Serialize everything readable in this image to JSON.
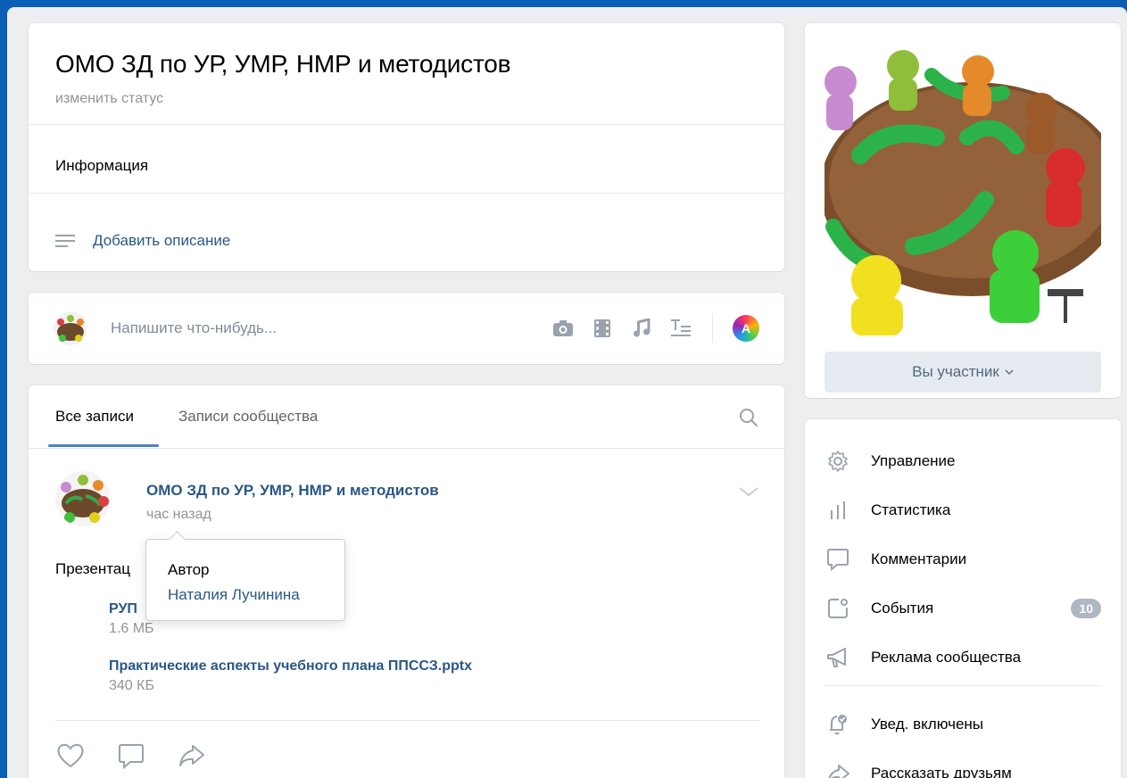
{
  "group": {
    "title": "ОМО ЗД по УР, УМР, НМР и методистов",
    "status_link": "изменить статус",
    "info_label": "Информация",
    "add_description": "Добавить описание"
  },
  "composer": {
    "placeholder": "Напишите что-нибудь...",
    "tools": [
      "camera-icon",
      "video-icon",
      "music-icon",
      "text-format-icon",
      "letter-a-icon"
    ],
    "letter_a": "A"
  },
  "feed": {
    "tabs": [
      {
        "label": "Все записи",
        "active": true
      },
      {
        "label": "Записи сообщества",
        "active": false
      }
    ],
    "post": {
      "author": "ОМО ЗД по УР, УМР, НМР и методистов",
      "time": "час назад",
      "text": "Презентац",
      "docs": [
        {
          "name": "РУП",
          "size": "1.6 МБ"
        },
        {
          "name": "Практические аспекты учебного плана ППССЗ.pptx",
          "size": "340 КБ"
        }
      ]
    },
    "tooltip": {
      "title": "Автор",
      "name": "Наталия Лучинина"
    }
  },
  "sidebar": {
    "member_button": "Вы участник",
    "menu": [
      {
        "label": "Управление",
        "icon": "gear-icon"
      },
      {
        "label": "Статистика",
        "icon": "stats-icon"
      },
      {
        "label": "Комментарии",
        "icon": "comment-icon"
      },
      {
        "label": "События",
        "icon": "events-icon",
        "badge": "10"
      },
      {
        "label": "Реклама сообщества",
        "icon": "megaphone-icon"
      },
      {
        "label": "Увед. включены",
        "icon": "bell-icon"
      },
      {
        "label": "Рассказать друзьям",
        "icon": "share-icon"
      }
    ]
  },
  "colors": {
    "link": "#2a5885",
    "background": "#edeef0",
    "accent": "#5181b8",
    "frame": "#0a5fb4"
  }
}
